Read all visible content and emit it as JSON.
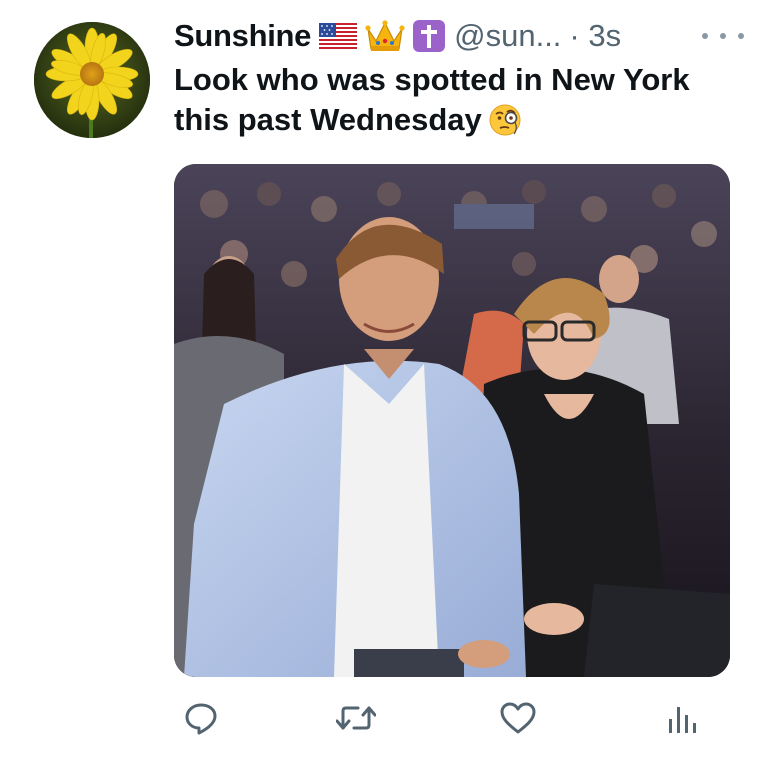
{
  "tweet": {
    "author": {
      "display_name": "Sunshine",
      "handle": "@sun...",
      "badges": [
        "us-flag-icon",
        "crown-icon",
        "latin-cross-icon"
      ]
    },
    "timestamp": "· 3s",
    "text": "Look who was spotted in New York this past Wednesday",
    "text_emoji": "face-with-monocle-icon",
    "media": {
      "type": "photo"
    }
  },
  "actions": [
    "reply-icon",
    "retweet-icon",
    "like-icon",
    "views-icon"
  ],
  "colors": {
    "text": "#0f1419",
    "secondary": "#536471",
    "icon": "#536471",
    "background": "#ffffff"
  }
}
